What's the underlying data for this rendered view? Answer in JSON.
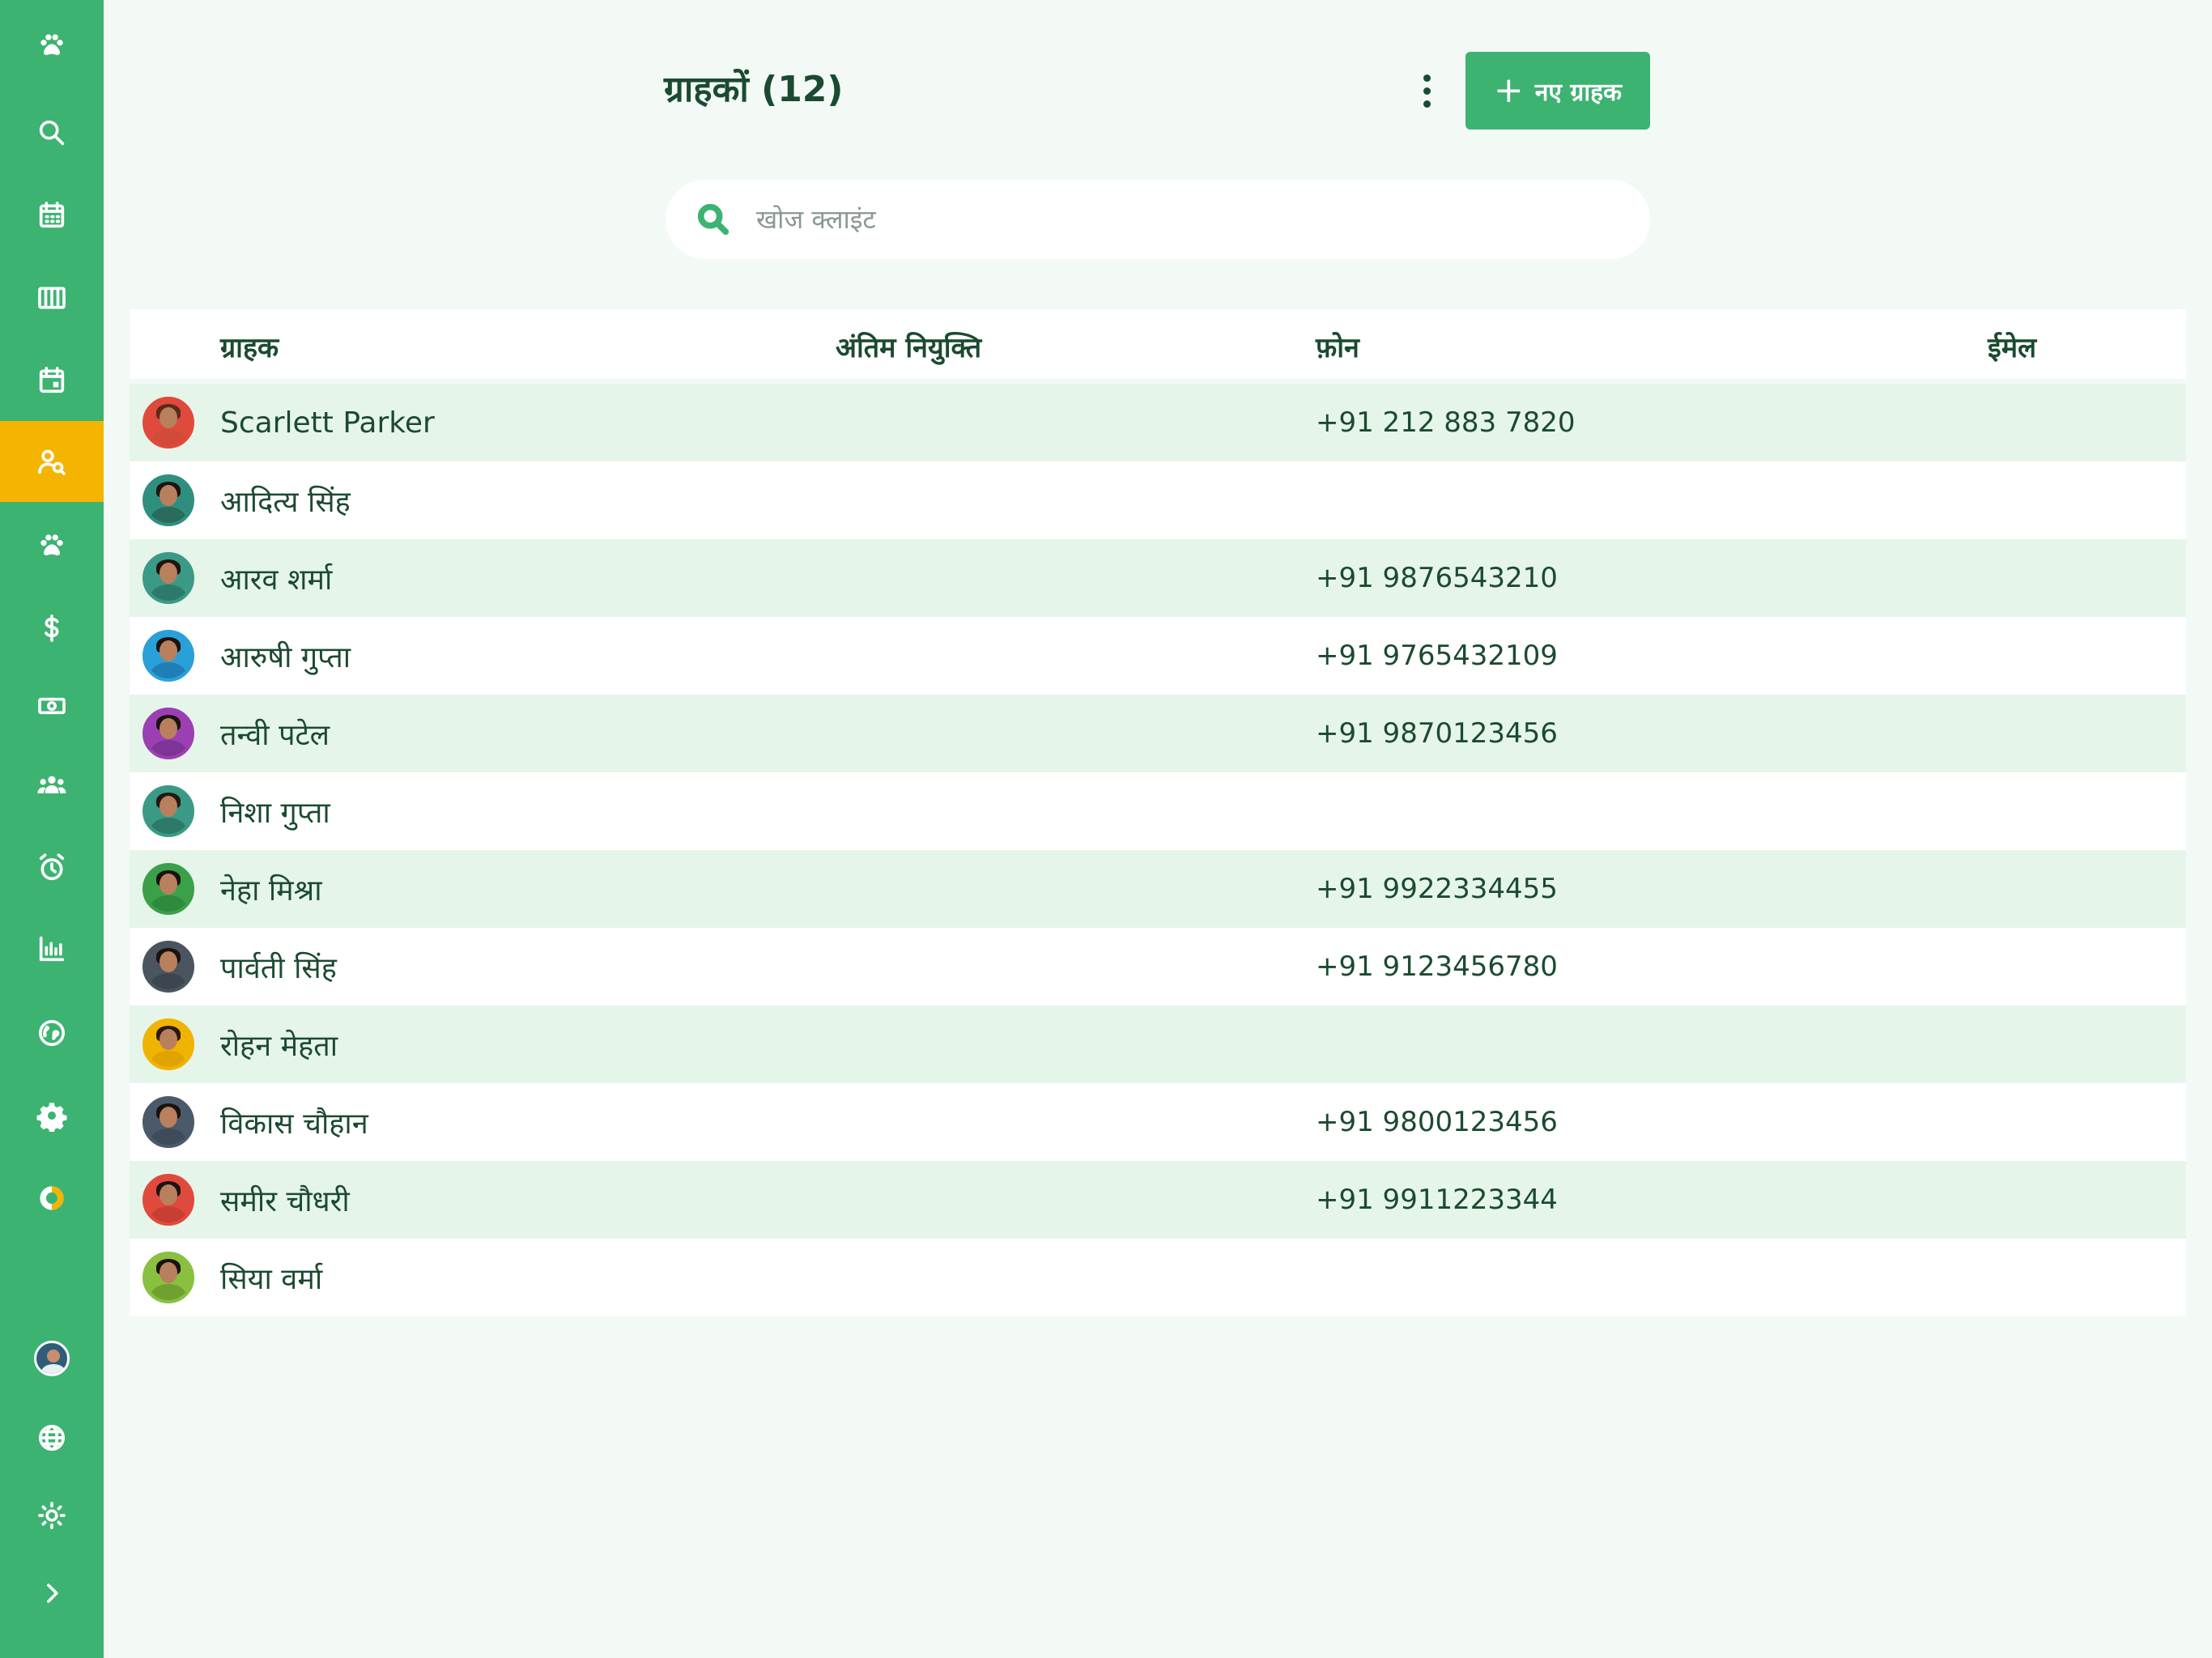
{
  "header": {
    "title": "ग्राहकों (12)",
    "new_button_label": "नए ग्राहक"
  },
  "search": {
    "placeholder": "खोज क्लाइंट",
    "value": ""
  },
  "sidebar": {
    "items": [
      {
        "icon": "paw-icon"
      },
      {
        "icon": "search-icon"
      },
      {
        "icon": "calendar-icon"
      },
      {
        "icon": "columns-icon"
      },
      {
        "icon": "calendar-event-icon"
      },
      {
        "icon": "client-search-icon",
        "active": true
      },
      {
        "icon": "paw-icon"
      },
      {
        "icon": "dollar-icon"
      },
      {
        "icon": "cash-icon"
      },
      {
        "icon": "group-icon"
      },
      {
        "icon": "alarm-icon"
      },
      {
        "icon": "bar-chart-icon"
      },
      {
        "icon": "globe-icon"
      },
      {
        "icon": "gear-icon"
      },
      {
        "icon": "donut-icon"
      },
      {
        "icon": "avatar"
      },
      {
        "icon": "language-icon"
      },
      {
        "icon": "brightness-icon"
      },
      {
        "icon": "chevron-right-icon"
      }
    ]
  },
  "table": {
    "columns": [
      "ग्राहक",
      "अंतिम नियुक्ति",
      "फ़ोन",
      "ईमेल"
    ],
    "rows": [
      {
        "name": "Scarlett Parker",
        "phone": "+91 212 883 7820",
        "ring": "#e04a3c",
        "shirt": "#d24a3a",
        "hair": "#5a2a1a"
      },
      {
        "name": "आदित्य सिंह",
        "phone": "",
        "ring": "#2f8f7f",
        "shirt": "#2a6b5c",
        "hair": "#1e1410"
      },
      {
        "name": "आरव शर्मा",
        "phone": "+91 9876543210",
        "ring": "#3a9a86",
        "shirt": "#2e7a6a",
        "hair": "#1e1410"
      },
      {
        "name": "आरुषी गुप्ता",
        "phone": "+91 9765432109",
        "ring": "#2aa0d8",
        "shirt": "#1f7fb5",
        "hair": "#1a1210"
      },
      {
        "name": "तन्वी पटेल",
        "phone": "+91 9870123456",
        "ring": "#9b3fb3",
        "shirt": "#7e3396",
        "hair": "#1a1210"
      },
      {
        "name": "निशा गुप्ता",
        "phone": "",
        "ring": "#3a9a86",
        "shirt": "#2e7a6a",
        "hair": "#241812"
      },
      {
        "name": "नेहा मिश्रा",
        "phone": "+91 9922334455",
        "ring": "#3aa04a",
        "shirt": "#2e8a3c",
        "hair": "#1a1210"
      },
      {
        "name": "पार्वती सिंह",
        "phone": "+91 9123456780",
        "ring": "#4a5560",
        "shirt": "#3d4650",
        "hair": "#1a1210"
      },
      {
        "name": "रोहन मेहता",
        "phone": "",
        "ring": "#f0b400",
        "shirt": "#e0a400",
        "hair": "#2a1a10"
      },
      {
        "name": "विकास चौहान",
        "phone": "+91 9800123456",
        "ring": "#4a5a6a",
        "shirt": "#3e4c5a",
        "hair": "#1a1210"
      },
      {
        "name": "समीर चौधरी",
        "phone": "+91 9911223344",
        "ring": "#e04a3c",
        "shirt": "#c93e32",
        "hair": "#1e1410"
      },
      {
        "name": "सिया वर्मा",
        "phone": "",
        "ring": "#8ac040",
        "shirt": "#6fa030",
        "hair": "#1a1210"
      }
    ]
  },
  "colors": {
    "sidebar": "#3cb371",
    "active": "#f5b400",
    "accent": "#3cb371",
    "row_alt": "#e6f5ea",
    "text": "#1b4a30"
  }
}
